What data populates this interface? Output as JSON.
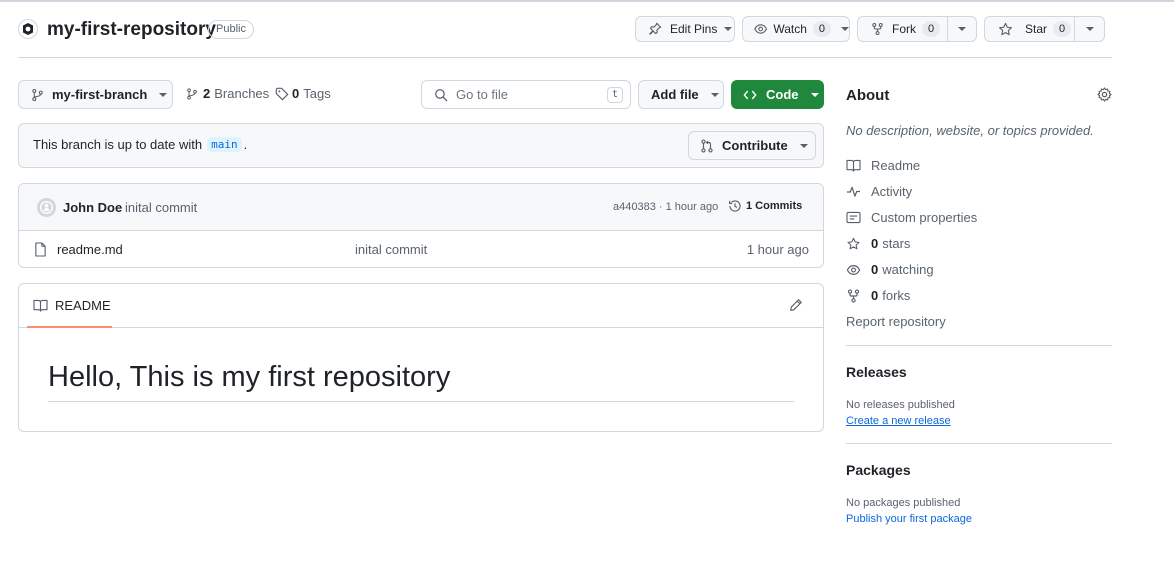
{
  "repo": {
    "name": "my-first-repository",
    "visibility": "Public"
  },
  "header_actions": {
    "edit_pins": "Edit Pins",
    "watch": "Watch",
    "watch_count": "0",
    "fork": "Fork",
    "fork_count": "0",
    "star": "Star",
    "star_count": "0"
  },
  "toolbar": {
    "branch": "my-first-branch",
    "branches_count": "2",
    "branches_label": "Branches",
    "tags_count": "0",
    "tags_label": "Tags",
    "search_placeholder": "Go to file",
    "search_shortcut": "t",
    "add_file": "Add file",
    "code": "Code"
  },
  "branch_status": {
    "text": "This branch is up to date with",
    "base_branch": "main",
    "suffix": ".",
    "contribute": "Contribute"
  },
  "commit_bar": {
    "author": "John Doe",
    "message": "inital commit",
    "hash_time": "a440383 · 1 hour ago",
    "commits_label": "1 Commits"
  },
  "files": [
    {
      "name": "readme.md",
      "message": "inital commit",
      "time": "1 hour ago"
    }
  ],
  "readme": {
    "tab": "README",
    "heading": "Hello, This is my first repository"
  },
  "about": {
    "title": "About",
    "description": "No description, website, or topics provided.",
    "readme": "Readme",
    "activity": "Activity",
    "custom_properties": "Custom properties",
    "stars_count": "0",
    "stars_label": "stars",
    "watching_count": "0",
    "watching_label": "watching",
    "forks_count": "0",
    "forks_label": "forks",
    "report": "Report repository"
  },
  "releases": {
    "title": "Releases",
    "empty": "No releases published",
    "create": "Create a new release"
  },
  "packages": {
    "title": "Packages",
    "empty": "No packages published",
    "publish": "Publish your first package"
  },
  "colors": {
    "accent": "#1f883d",
    "link": "#0969da",
    "border": "#d0d7de",
    "underline": "#fd8c73"
  }
}
